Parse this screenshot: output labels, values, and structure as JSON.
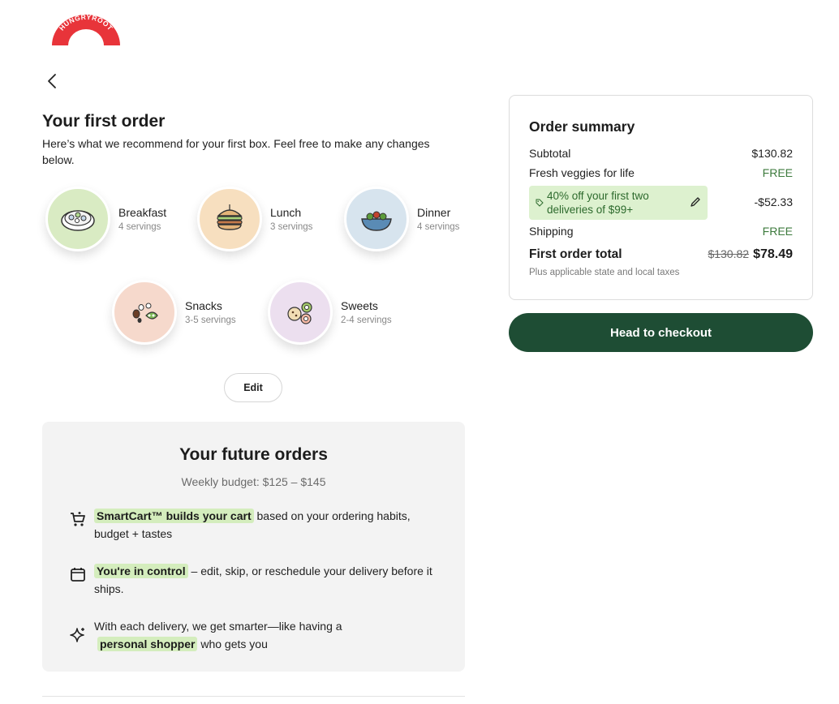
{
  "brand": {
    "logo_text": "HUNGRYROOT"
  },
  "first_order": {
    "title": "Your first order",
    "subtitle": "Here’s what we recommend for your first box. Feel free to make any changes below.",
    "categories": [
      {
        "name": "Breakfast",
        "servings": "4 servings",
        "bg": "#d9ebc3"
      },
      {
        "name": "Lunch",
        "servings": "3 servings",
        "bg": "#f7dfbf"
      },
      {
        "name": "Dinner",
        "servings": "4 servings",
        "bg": "#d7e4ee"
      },
      {
        "name": "Snacks",
        "servings": "3-5 servings",
        "bg": "#f6d9cc"
      },
      {
        "name": "Sweets",
        "servings": "2-4 servings",
        "bg": "#ecdfef"
      }
    ],
    "edit_label": "Edit"
  },
  "future_orders": {
    "title": "Your future orders",
    "budget": "Weekly budget: $125 – $145",
    "features": [
      {
        "icon": "cart-icon",
        "highlight": "SmartCart™ builds your cart",
        "text": " based on your ordering habits, budget + tastes"
      },
      {
        "icon": "calendar-icon",
        "highlight": "You're in control",
        "text": " – edit, skip, or reschedule your delivery before it ships."
      },
      {
        "icon": "sparkle-icon",
        "pre": "With each delivery, we get smarter—like having a ",
        "highlight": "personal shopper",
        "text": " who gets you"
      }
    ]
  },
  "summary": {
    "title": "Order summary",
    "subtotal_label": "Subtotal",
    "subtotal_value": "$130.82",
    "veggies_label": "Fresh veggies for life",
    "veggies_value": "FREE",
    "promo_text": "40% off your first two deliveries of $99+",
    "promo_value": "-$52.33",
    "shipping_label": "Shipping",
    "shipping_value": "FREE",
    "total_label": "First order total",
    "total_original": "$130.82",
    "total_value": "$78.49",
    "tax_note": "Plus applicable state and local taxes",
    "colors": {
      "free": "#3c7a3c",
      "promo_bg": "#ddf1cf"
    }
  },
  "checkout_label": "Head to checkout",
  "colors": {
    "checkout_bg": "#1e4d34",
    "highlight": "#d4edbd",
    "logo": "#e8343a"
  }
}
